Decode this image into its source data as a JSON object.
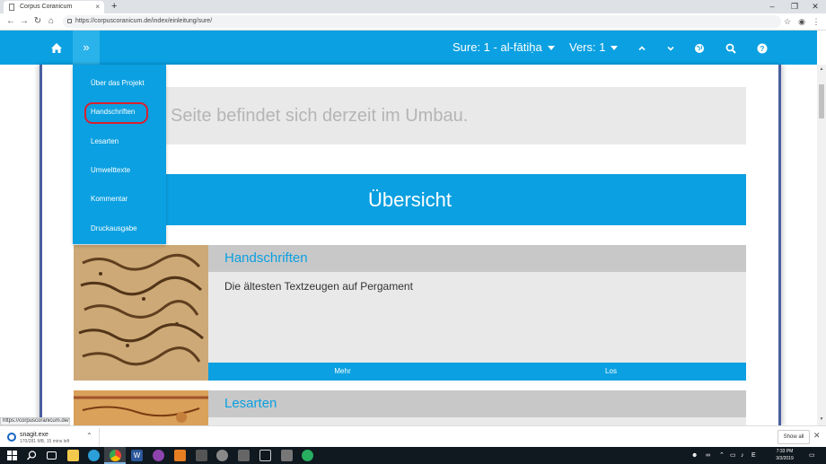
{
  "browser": {
    "tab_title": "Corpus Coranicum",
    "tab_close": "×",
    "new_tab": "+",
    "url": "https://corpuscoranicum.de/index/einleitung/sure/",
    "status_url": "https://corpuscoranicum.de/#"
  },
  "navbar": {
    "sure_label": "Sure: 1 - al-fātiḥa",
    "vers_label": "Vers: 1",
    "menu_icon": "»",
    "icons": [
      "home-icon",
      "double-chevron-icon",
      "chevron-up-icon",
      "chevron-down-icon",
      "globe-icon",
      "search-icon",
      "help-icon"
    ]
  },
  "dropdown": {
    "items": [
      "Über das Projekt",
      "Handschriften",
      "Lesarten",
      "Umwelttexte",
      "Kommentar",
      "Druckausgabe"
    ],
    "highlighted": "Handschriften"
  },
  "main": {
    "notice": "Seite befindet sich derzeit im Umbau.",
    "overview_title": "Übersicht",
    "cards": [
      {
        "title": "Handschriften",
        "description": "Die ältesten Textzeugen auf Pergament",
        "links": [
          "Mehr",
          "Los"
        ]
      },
      {
        "title": "Lesarten"
      }
    ]
  },
  "downloads": {
    "file_name": "snagit.exe",
    "status": "170/281 MB, 15 mins left",
    "show_all": "Show all"
  },
  "taskbar": {
    "time": "7:33 PM",
    "date": "3/3/2019",
    "lang": "E"
  },
  "colors": {
    "accent": "#0ba0e1",
    "notice_bg": "#e9e9e9",
    "card_header_bg": "#c8c8c8",
    "highlight_ring": "#d8202f"
  }
}
